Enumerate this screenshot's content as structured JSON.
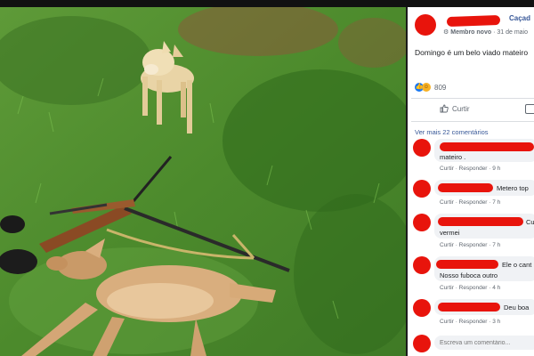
{
  "post": {
    "group_name": "Caçad",
    "badge": "Membro novo",
    "date": "31 de maio",
    "text": "Domingo é um belo viado mateiro",
    "reaction_count": "809",
    "like_action": "Curtir"
  },
  "comments_link": "Ver mais 22 comentários",
  "comments": [
    {
      "text": "mateiro .",
      "like": "Curtir",
      "reply": "Responder",
      "time": "9 h"
    },
    {
      "text": "Metero top",
      "like": "Curtir",
      "reply": "Responder",
      "time": "7 h"
    },
    {
      "text": "Cu",
      "text2": "vermei",
      "like": "Curtir",
      "reply": "Responder",
      "time": "7 h"
    },
    {
      "text": "Ele o cant",
      "text2": "Nosso fuboca outro",
      "like": "Curtir",
      "reply": "Responder",
      "time": "4 h"
    },
    {
      "text": "Deu boa",
      "like": "Curtir",
      "reply": "Responder",
      "time": "3 h"
    }
  ],
  "composer": {
    "placeholder": "Escreva um comentário..."
  },
  "colors": {
    "redaction": "#e8140c",
    "link": "#385898",
    "grass": "#4f8a2e"
  }
}
